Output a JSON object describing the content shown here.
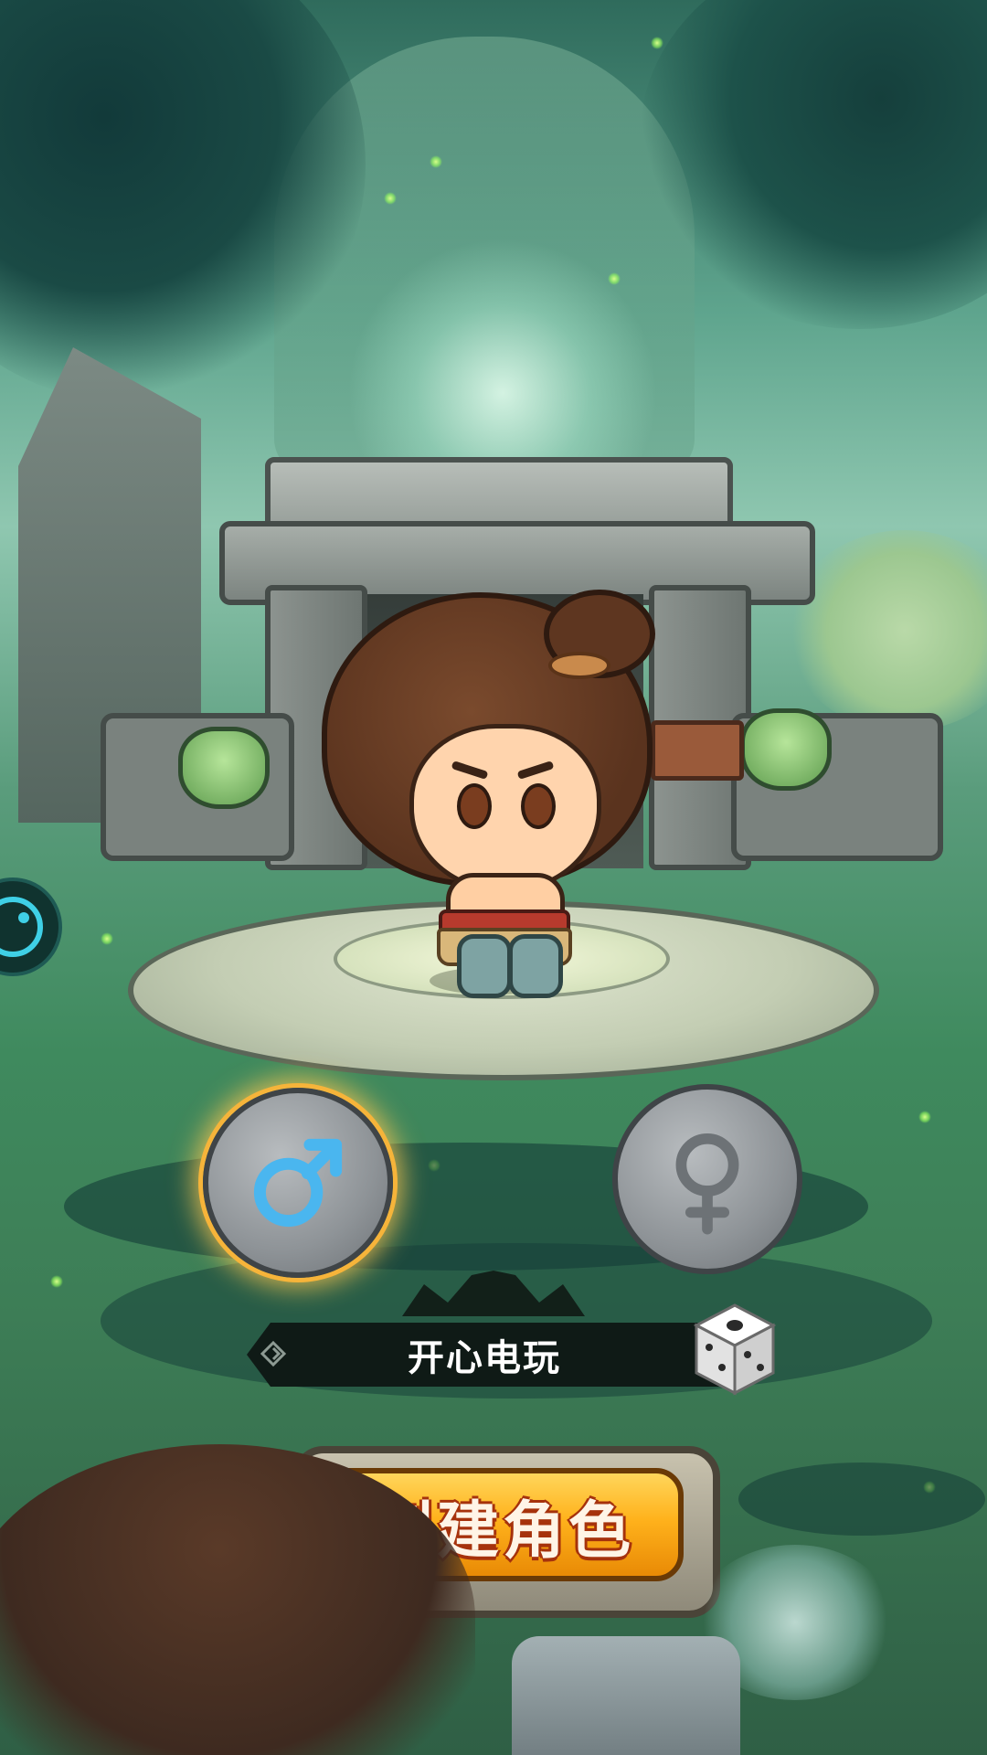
{
  "character_creation": {
    "gender_options": [
      {
        "name": "male",
        "symbol": "♂",
        "selected": true,
        "color": "#4ab6ef"
      },
      {
        "name": "female",
        "symbol": "♀",
        "selected": false,
        "color": "#7d8285"
      }
    ],
    "character_name": "开心电玩",
    "random_name_icon": "dice-icon",
    "create_button_label": "创建角色"
  },
  "colors": {
    "accent_gold": "#ffb21c",
    "selected_glow": "#f6b43a",
    "name_bar": "#0f1a16"
  }
}
